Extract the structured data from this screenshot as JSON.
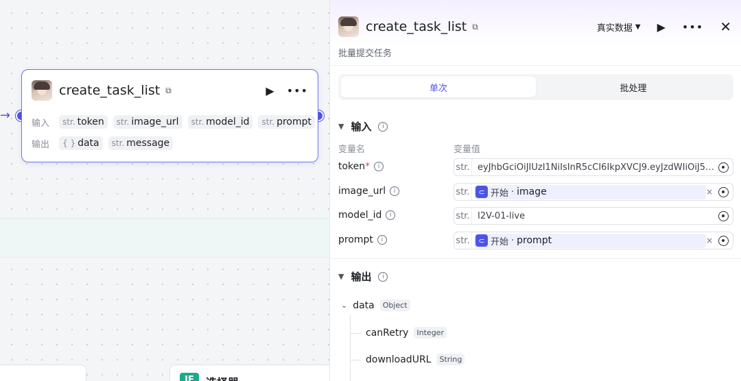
{
  "canvas": {
    "node": {
      "title": "create_task_list",
      "input_label": "输入",
      "output_label": "输出",
      "inputs": [
        {
          "type": "str.",
          "name": "token"
        },
        {
          "type": "str.",
          "name": "image_url"
        },
        {
          "type": "str.",
          "name": "model_id"
        },
        {
          "type": "str.",
          "name": "prompt"
        }
      ],
      "outputs": [
        {
          "type": "{ }",
          "name": "data"
        },
        {
          "type": "str.",
          "name": "message"
        }
      ]
    },
    "selector_node": {
      "badge": "IF",
      "label": "选择器"
    }
  },
  "panel": {
    "title": "create_task_list",
    "subtitle": "批量提交任务",
    "data_mode": "真实数据",
    "tabs": [
      {
        "label": "单次",
        "active": true
      },
      {
        "label": "批处理",
        "active": false
      }
    ],
    "input_section": {
      "title": "输入",
      "col_name": "变量名",
      "col_value": "变量值",
      "fields": [
        {
          "name": "token",
          "required": "*",
          "type": "str.",
          "value": "eyJhbGciOiJIUzI1NiIsInR5cCI6IkpXVCJ9.eyJzdWIiOiJ5…"
        },
        {
          "name": "image_url",
          "type": "str.",
          "ref_source": "开始",
          "ref_var": "image",
          "clear": "×"
        },
        {
          "name": "model_id",
          "type": "str.",
          "value": "I2V-01-live"
        },
        {
          "name": "prompt",
          "type": "str.",
          "ref_source": "开始",
          "ref_var": "prompt",
          "clear": "×"
        }
      ]
    },
    "output_section": {
      "title": "输出",
      "tree": [
        {
          "name": "data",
          "type": "Object"
        },
        {
          "name": "canRetry",
          "type": "Integer"
        },
        {
          "name": "downloadURL",
          "type": "String"
        }
      ]
    }
  },
  "colors": {
    "accent": "#4d53e8",
    "canvas_bg": "#f4f5f7",
    "required": "#e5484d"
  }
}
